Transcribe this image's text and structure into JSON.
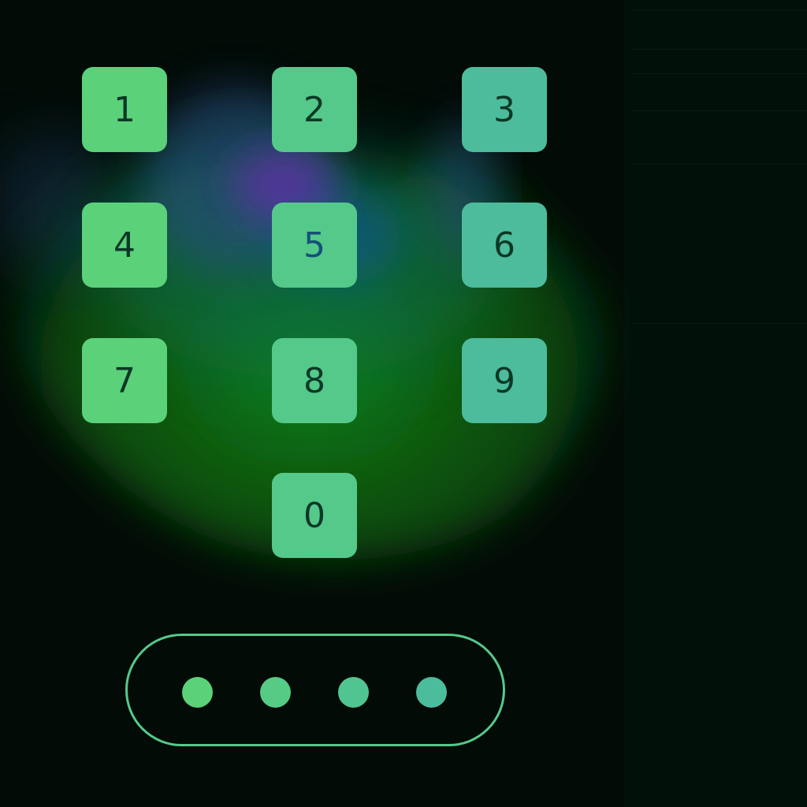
{
  "keypad": {
    "keys": [
      "1",
      "2",
      "3",
      "4",
      "5",
      "6",
      "7",
      "8",
      "9",
      "0"
    ]
  },
  "pin": {
    "entered_digits": 4,
    "length": 4,
    "mask_char": "•"
  },
  "colors": {
    "background": "#020b06",
    "key_green": "#5bd17a",
    "key_teal": "#4cbc9c",
    "key_text": "#0b3826",
    "key_five_text": "#14507a",
    "pin_border": "#55c98b",
    "glow_green": "#1a6b1a",
    "glow_blue": "#1c5a8a",
    "glow_purple": "#5a2aa0"
  }
}
